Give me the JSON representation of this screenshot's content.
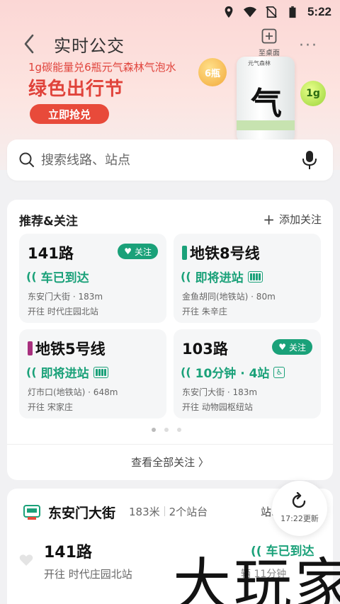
{
  "status_bar": {
    "time": "5:22"
  },
  "nav": {
    "title": "实时公交",
    "desk_label": "至桌面"
  },
  "promo": {
    "subtitle": "1g碳能量兑6瓶元气森林气泡水",
    "title": "绿色出行节",
    "button": "立即抢兑",
    "medal_text": "6瓶",
    "can_brand": "元气森林",
    "can_glyph": "气",
    "ball_text": "1g"
  },
  "search": {
    "placeholder": "搜索线路、站点"
  },
  "recommend": {
    "title": "推荐&关注",
    "add_label": "添加关注",
    "follow_label": "关注",
    "cards": [
      {
        "route": "141路",
        "status": "车已到达",
        "stop": "东安门大街 · 183m",
        "direction": "开往 时代庄园北站",
        "followed": true,
        "bar_color": ""
      },
      {
        "route": "地铁8号线",
        "status": "即将进站",
        "stop": "金鱼胡同(地铁站) · 80m",
        "direction": "开往 朱辛庄",
        "followed": false,
        "bar_color": "#1aa179"
      },
      {
        "route": "地铁5号线",
        "status": "即将进站",
        "stop": "灯市口(地铁站) · 648m",
        "direction": "开往 宋家庄",
        "followed": false,
        "bar_color": "#a8307e"
      },
      {
        "route": "103路",
        "status": "10分钟 · 4站",
        "stop": "东安门大街 · 183m",
        "direction": "开往 动物园枢纽站",
        "followed": true,
        "bar_color": ""
      }
    ],
    "view_all": "查看全部关注 〉"
  },
  "nearby": {
    "station": "东安门大街",
    "distance": "183米",
    "platforms": "2个站台",
    "more": "站.",
    "route": "141路",
    "direction": "开往 时代庄园北站",
    "status": "车已到达",
    "next": "辆 11分钟"
  },
  "refresh": {
    "label": "17:22更新"
  },
  "watermark": "大玩家",
  "colors": {
    "accent": "#1aa179",
    "promo_red": "#e0433b"
  }
}
